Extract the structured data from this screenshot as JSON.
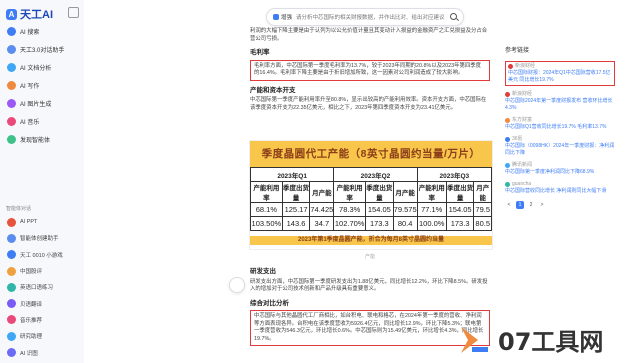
{
  "app": {
    "logo_text": "天工AI"
  },
  "nav": [
    {
      "label": "AI 搜索",
      "color": "#3f7df5"
    },
    {
      "label": "天工3.0对话助手",
      "color": "#5b8def"
    },
    {
      "label": "AI 文档分析",
      "color": "#3fa7f5"
    },
    {
      "label": "AI 写作",
      "color": "#f08a3f"
    },
    {
      "label": "AI 图片生成",
      "color": "#9b59f5"
    },
    {
      "label": "AI 音乐",
      "color": "#e94a7a"
    },
    {
      "label": "发现智能体",
      "color": "#3fc28a"
    }
  ],
  "agents_title": "智能体对话",
  "agents": [
    {
      "label": "AI PPT",
      "color": "#e6543b"
    },
    {
      "label": "智能体创建助手",
      "color": "#5b8def"
    },
    {
      "label": "天工 0010 小游戏",
      "color": "#3f7df5"
    },
    {
      "label": "中国股评",
      "color": "#f0a13f"
    },
    {
      "label": "英语口语练习",
      "color": "#2fb6a8"
    },
    {
      "label": "贝语翻译",
      "color": "#7a5bf5"
    },
    {
      "label": "音乐推荐",
      "color": "#e94a7a"
    },
    {
      "label": "研究助理",
      "color": "#3fa7f5"
    },
    {
      "label": "AI 识图",
      "color": "#6b6bf5"
    }
  ],
  "search": {
    "mode": "增强",
    "text": "请分析中芯国际的相关财报数据，并作出比对、给出对应建议"
  },
  "article": {
    "intro": "利润的大幅下降主要是由于认列为以公允价值计量且其变动计入损益的金融资产之汇兑损益及分占合营公司亏损。",
    "h1": "毛利率",
    "p1": "毛利率方面，中芯国际第一季度毛利率为13.7%，较于2023年同期的20.8%以及2023年第四季度的16.4%。毛利率下降主要是由于折旧增加所致，这一因素对公司利润造成了较大影响。",
    "h2": "产能和资本开支",
    "p2": "中芯国际第一季度产能利用率升至80.8%，显示出较高的产能利用效率。资本开支方面，中芯国际在该季度资本开支为22.35亿美元，相比之下，2023年第四季度资本开支为23.41亿美元。",
    "h3": "研发支出",
    "p3": "研发支出方面，中芯国际第一季度研发支出为1.88亿美元，同比增长12.2%，环比下降8.5%。研发投入的增加对于公司技术创新和产品升级具有重要意义。",
    "h4": "综合对比分析",
    "p4": "中芯国际与其他晶圆代工厂商相比，如台积电、联电和格芯，在2024年第一季度的营收、净利润等方面表现各异。台积电在该季度营收为5926.4亿元，同比增长12.9%，环比下降5.3%；联电第一季度营收为546.3亿元，环比增长0.6%。中芯国际则为15.49亿美元，环比增长4.3%，同比增长19.7%。"
  },
  "figure": {
    "title": "季度晶圆代工产能（8英寸晶圆约当量/万片）",
    "headers": [
      "2023年Q1",
      "2023年Q2",
      "2023年Q3"
    ],
    "cols": [
      "产能利用率",
      "季度出货量",
      "月产能",
      "产能利用率",
      "季度出货量",
      "月产能",
      "产能利用率",
      "季度出货量",
      "月产能"
    ],
    "rows": [
      [
        "68.1%",
        "125.17",
        "74.425",
        "78.3%",
        "154.05",
        "79.575",
        "77.1%",
        "154.05",
        "79.5"
      ],
      [
        "103.50%",
        "143.6",
        "34.7",
        "102.70%",
        "173.3",
        "80.4",
        "100.0%",
        "173.3",
        "80.5"
      ]
    ],
    "note": "2023年第1季度晶圆产能，折合为每月8英寸晶圆约当量",
    "caption": "产能"
  },
  "refs": {
    "title": "参考链接",
    "items": [
      {
        "src": "新浪财经",
        "title": "中芯国际财报：2024年Q1中芯国际营收17.5亿美元 同比增长19.7%",
        "snippet": "中芯国际第一季度 营收同比增长19.7%...",
        "color": "#e23b3b",
        "boxed": true
      },
      {
        "src": "新浪财经",
        "title": "中芯国际2024年第一季度财报发布 营收环比增长4.3%",
        "snippet": "...",
        "color": "#e23b3b",
        "boxed": false
      },
      {
        "src": "东方财富",
        "title": "中芯国际Q1营收同比增长19.7% 毛利率13.7%",
        "snippet": "...",
        "color": "#f08a3f",
        "boxed": false
      },
      {
        "src": "36氪",
        "title": "中芯国际（0098HK）2024年一季度财报：净利润同比下降",
        "snippet": "...",
        "color": "#3f7df5",
        "boxed": false
      },
      {
        "src": "腾讯新闻",
        "title": "中芯国际第一季度净利润同比下降68.9%",
        "snippet": "...",
        "color": "#3fa7f5",
        "boxed": false
      },
      {
        "src": "guancha",
        "title": "中芯国际营收同比增长 净利润则同比大幅下滑",
        "snippet": "...",
        "color": "#2fb6a8",
        "boxed": false
      }
    ],
    "pages": [
      "<",
      "1",
      "2",
      ">"
    ]
  },
  "watermark": {
    "text": "07工具网"
  }
}
